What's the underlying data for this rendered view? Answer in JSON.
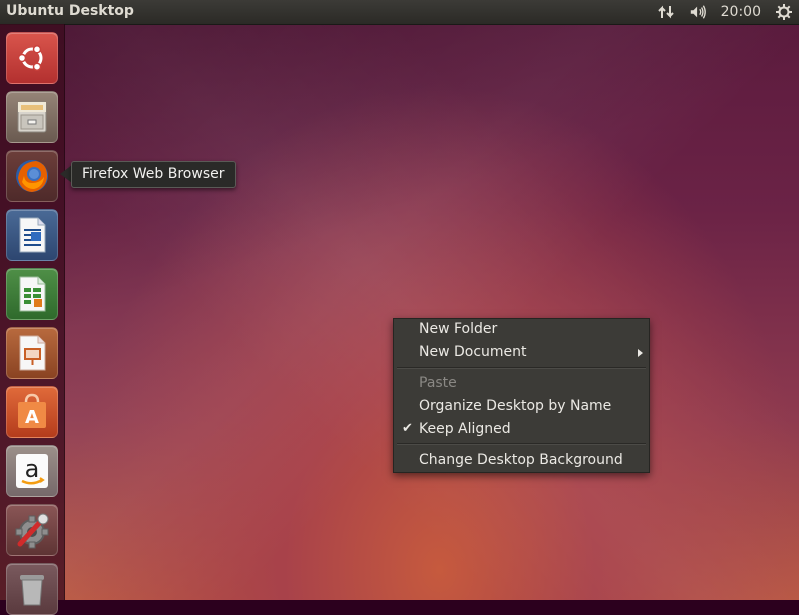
{
  "panel": {
    "title": "Ubuntu Desktop",
    "clock": "20:00",
    "icons": [
      "network-transfer-icon",
      "volume-icon",
      "power-gear-icon"
    ]
  },
  "launcher": {
    "items": [
      {
        "name": "ubuntu-dash",
        "icon": "ubuntu-logo-icon",
        "bg": "#c9413c"
      },
      {
        "name": "files",
        "icon": "file-cabinet-icon",
        "bg": "#7a6a5e"
      },
      {
        "name": "firefox",
        "icon": "firefox-icon",
        "bg": "#5e3432"
      },
      {
        "name": "libreoffice-writer",
        "icon": "writer-document-icon",
        "bg": "#3d5a84"
      },
      {
        "name": "libreoffice-calc",
        "icon": "calc-spreadsheet-icon",
        "bg": "#3f7a3a"
      },
      {
        "name": "libreoffice-impress",
        "icon": "impress-presentation-icon",
        "bg": "#a8562e"
      },
      {
        "name": "ubuntu-software-center",
        "icon": "software-center-bag-icon",
        "bg": "#c44c27"
      },
      {
        "name": "amazon",
        "icon": "amazon-icon",
        "bg": "#8a7d78"
      },
      {
        "name": "system-settings",
        "icon": "settings-wrench-gear-icon",
        "bg": "#7c4a4a"
      },
      {
        "name": "trash",
        "icon": "trash-icon",
        "bg": "#6c4a4e"
      }
    ]
  },
  "tooltip": {
    "text": "Firefox Web Browser"
  },
  "context_menu": {
    "items": [
      {
        "label": "New Folder",
        "enabled": true
      },
      {
        "label": "New Document",
        "enabled": true,
        "submenu": true
      },
      {
        "label": "Paste",
        "enabled": false
      },
      {
        "label": "Organize Desktop by Name",
        "enabled": true
      },
      {
        "label": "Keep Aligned",
        "enabled": true,
        "checked": true
      },
      {
        "label": "Change Desktop Background",
        "enabled": true
      }
    ],
    "check_glyph": "✔"
  }
}
